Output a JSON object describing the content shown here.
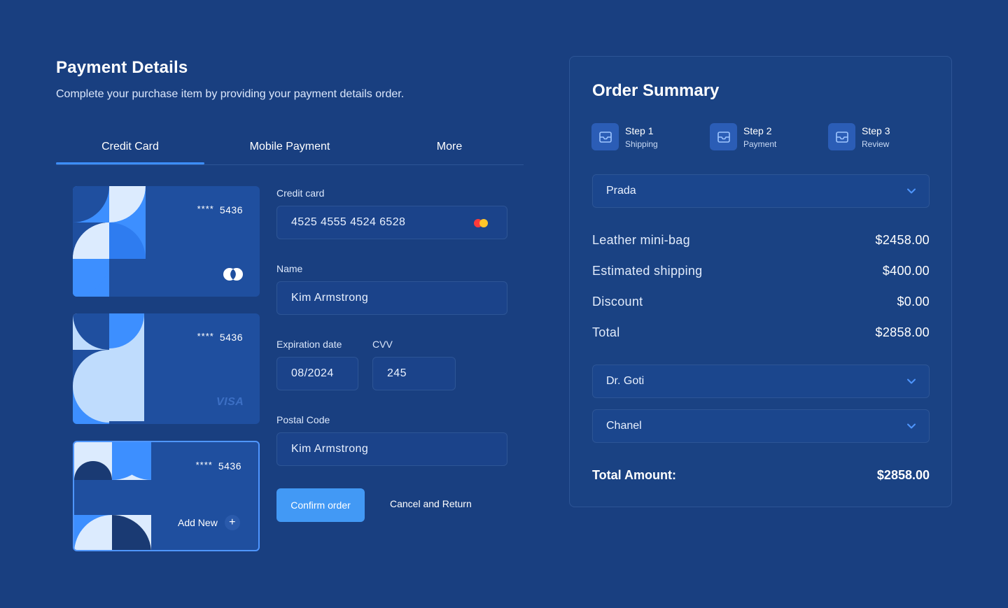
{
  "header": {
    "title": "Payment Details",
    "subtitle": "Complete your purchase item by providing your payment details order."
  },
  "tabs": [
    {
      "label": "Credit Card",
      "active": true
    },
    {
      "label": "Mobile Payment",
      "active": false
    },
    {
      "label": "More",
      "active": false
    }
  ],
  "cards": [
    {
      "masked": "****",
      "last4": "5436",
      "brand": "mastercard-icon"
    },
    {
      "masked": "****",
      "last4": "5436",
      "brand_label": "VISA"
    },
    {
      "masked": "****",
      "last4": "5436",
      "add_label": "Add New",
      "plus": "+"
    }
  ],
  "form": {
    "card_label": "Credit card",
    "card_value": "4525 4555 4524 6528",
    "name_label": "Name",
    "name_value": "Kim Armstrong",
    "exp_label": "Expiration date",
    "exp_value": "08/2024",
    "cvv_label": "CVV",
    "cvv_value": "245",
    "postal_label": "Postal Code",
    "postal_value": "Kim Armstrong",
    "confirm_label": "Confirm order",
    "cancel_label": "Cancel and Return"
  },
  "summary": {
    "title": "Order Summary",
    "steps": [
      {
        "title": "Step 1",
        "sub": "Shipping",
        "icon": "inbox-icon"
      },
      {
        "title": "Step 2",
        "sub": "Payment",
        "icon": "inbox-icon"
      },
      {
        "title": "Step 3",
        "sub": "Review",
        "icon": "inbox-icon"
      }
    ],
    "select1": "Prada",
    "items": [
      {
        "label": "Leather mini-bag",
        "value": "$2458.00"
      },
      {
        "label": "Estimated shipping",
        "value": "$400.00"
      },
      {
        "label": "Discount",
        "value": "$0.00"
      },
      {
        "label": "Total",
        "value": "$2858.00"
      }
    ],
    "select2": "Dr. Goti",
    "select3": "Chanel",
    "total_label": "Total Amount:",
    "total_value": "$2858.00"
  },
  "colors": {
    "background": "#193f80",
    "accent": "#4299f5",
    "card": "#1f4f9f",
    "mastercard_red": "#ff3a3a",
    "mastercard_yellow": "#ffc529"
  }
}
